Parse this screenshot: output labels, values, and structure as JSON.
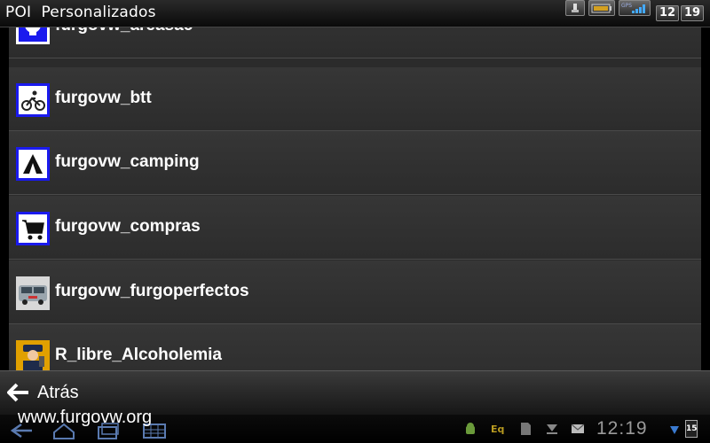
{
  "window": {
    "title": "POI  Personalizados",
    "clock_hour": "12",
    "clock_min": "19"
  },
  "poi_list": {
    "items": [
      {
        "label": "furgovw_areasac",
        "icon": "skull-icon"
      },
      {
        "label": "furgovw_btt",
        "icon": "mountain-bike-icon"
      },
      {
        "label": "furgovw_camping",
        "icon": "tent-icon"
      },
      {
        "label": "furgovw_compras",
        "icon": "shopping-cart-icon"
      },
      {
        "label": "furgovw_furgoperfectos",
        "icon": "van-photo-icon"
      },
      {
        "label": "R_libre_Alcoholemia",
        "icon": "police-officer-icon"
      }
    ]
  },
  "back_bar": {
    "label": "Atrás"
  },
  "watermark": "www.furgovw.org",
  "system_bar": {
    "clock": "12:19",
    "eq_label": "Eq",
    "notification_count": "15"
  },
  "colors": {
    "icon_blue": "#1a1aee",
    "row_bg": "#333333",
    "row_divider": "#4a4a4a",
    "text": "#ffffff"
  }
}
